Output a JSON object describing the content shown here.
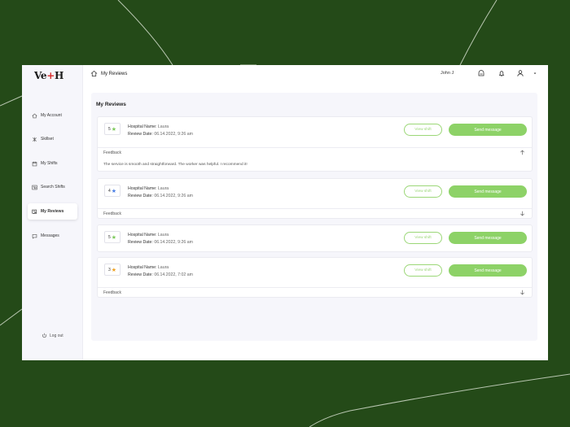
{
  "app": {
    "logo": {
      "part1": "Ve",
      "plus": "+",
      "part2": "H"
    },
    "breadcrumb": "My Reviews",
    "user_name": "John J"
  },
  "sidebar": {
    "items": [
      {
        "label": "My Account",
        "icon": "home-icon",
        "active": false
      },
      {
        "label": "Skillset",
        "icon": "skillset-icon",
        "active": false
      },
      {
        "label": "My Shifts",
        "icon": "calendar-icon",
        "active": false
      },
      {
        "label": "Search Shifts",
        "icon": "search-list-icon",
        "active": false
      },
      {
        "label": "My Reviews",
        "icon": "review-icon",
        "active": true
      },
      {
        "label": "Messages",
        "icon": "messages-icon",
        "active": false
      }
    ],
    "logout": "Log out"
  },
  "content": {
    "title": "My Reviews",
    "hospital_label": "Hospital Name:",
    "date_label": "Review Date:",
    "view_shift": "View shift",
    "send_message": "Send message",
    "feedback_label": "Feedback",
    "reviews": [
      {
        "rating": "5",
        "star_color": "#7cc95a",
        "hospital": "Laura",
        "date": "06.14.2022, 9:26 am",
        "expanded": true,
        "feedback": "The service is smooth and straightforward. The worker was helpful. I recommend it!"
      },
      {
        "rating": "4",
        "star_color": "#4a7fe6",
        "hospital": "Laura",
        "date": "06.14.2022, 9:26 am",
        "expanded": false
      },
      {
        "rating": "5",
        "star_color": "#7cc95a",
        "hospital": "Laura",
        "date": "06.14.2022, 9:26 am",
        "no_feedback": true
      },
      {
        "rating": "3",
        "star_color": "#f0a020",
        "hospital": "Laura",
        "date": "06.14.2022, 7:02 am",
        "expanded": false
      }
    ]
  },
  "colors": {
    "accent": "#8dd267",
    "background": "#244a18"
  }
}
